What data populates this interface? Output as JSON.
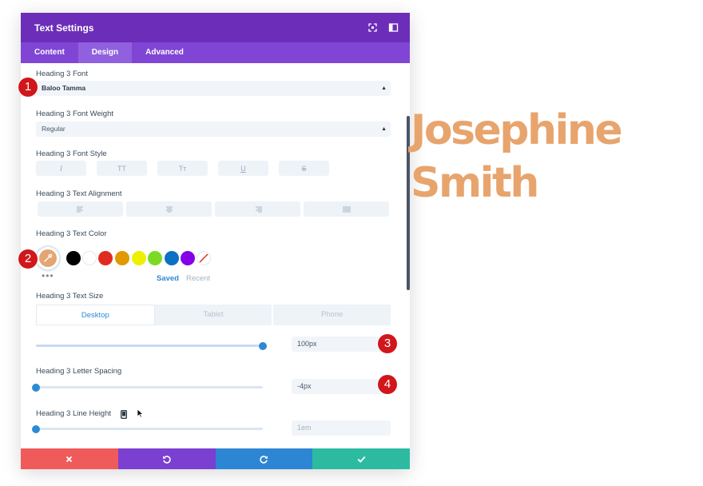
{
  "modal": {
    "title": "Text Settings",
    "tabs": [
      {
        "label": "Content",
        "active": false
      },
      {
        "label": "Design",
        "active": true
      },
      {
        "label": "Advanced",
        "active": false
      }
    ]
  },
  "settings": {
    "font": {
      "label": "Heading 3 Font",
      "value": "Baloo Tamma"
    },
    "weight": {
      "label": "Heading 3 Font Weight",
      "value": "Regular"
    },
    "style": {
      "label": "Heading 3 Font Style",
      "buttons": [
        "I",
        "TT",
        "Tт",
        "U",
        "S"
      ]
    },
    "alignment": {
      "label": "Heading 3 Text Alignment"
    },
    "color": {
      "label": "Heading 3 Text Color",
      "selected": "#e5a572",
      "swatches": [
        "#000000",
        "#ffffff",
        "#e02b20",
        "#e09900",
        "#edf000",
        "#7cda24",
        "#0c71c3",
        "#8300e9"
      ],
      "saved_label": "Saved",
      "recent_label": "Recent"
    },
    "size": {
      "label": "Heading 3 Text Size",
      "devices": [
        "Desktop",
        "Tablet",
        "Phone"
      ],
      "value": "100px",
      "slider_fraction": 1.0
    },
    "letter_spacing": {
      "label": "Heading 3 Letter Spacing",
      "value": "-4px",
      "slider_fraction": 0.0
    },
    "line_height": {
      "label": "Heading 3 Line Height",
      "value": "1em",
      "slider_fraction": 0.0
    }
  },
  "markers": [
    "1",
    "2",
    "3",
    "4"
  ],
  "preview": {
    "line1": "Josephine",
    "line2": "Smith"
  },
  "colors": {
    "header": "#6c2eb9",
    "tabs": "#8045d4",
    "accent": "#2c8ad5",
    "cancel": "#ef5a5a",
    "undo": "#7b3fd1",
    "redo": "#2c86d3",
    "save": "#2cbba0",
    "preview_text": "#e8a46d"
  }
}
